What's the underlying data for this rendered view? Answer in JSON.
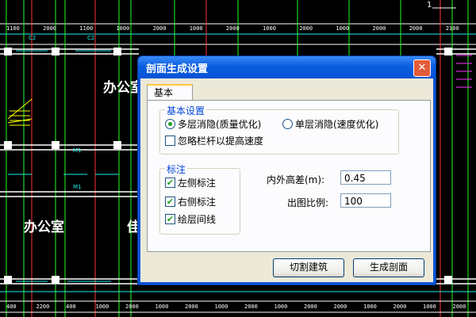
{
  "background": {
    "room_labels": [
      "办公室",
      "办公室",
      "佳"
    ],
    "dimension_top": [
      "1100",
      "2000",
      "1100",
      "1000",
      "2000",
      "1000",
      "2000",
      "1000",
      "2000",
      "1000",
      "2000",
      "2000",
      "2100"
    ],
    "dimension_bottom": [
      "400",
      "2200",
      "400",
      "1000",
      "2000",
      "1000",
      "2000",
      "1000",
      "2000",
      "1000",
      "2000",
      "2000",
      "1000",
      "2000",
      "1000",
      "2000"
    ],
    "misc_labels": [
      "C2",
      "C2",
      "M1",
      "M1",
      "1"
    ]
  },
  "dialog": {
    "title": "剖面生成设置",
    "tab": "基本",
    "basic_group": {
      "label": "基本设置",
      "option_multi": "多层消隐(质量优化)",
      "option_single": "单层消隐(速度优化)",
      "ignore_railing": "忽略栏杆以提高速度"
    },
    "annotation_group": {
      "label": "标注",
      "left": "左侧标注",
      "right": "右侧标注",
      "draw_lines": "绘层间线"
    },
    "elev_diff": {
      "label": "内外高差(m):",
      "value": "0.45"
    },
    "scale": {
      "label": "出图比例:",
      "value": "100"
    },
    "buttons": {
      "cut": "切割建筑",
      "generate": "生成剖面"
    }
  },
  "colors": {
    "title_bar": "#0a5ee0",
    "client": "#ece9d8",
    "accent_green": "#21a121",
    "cad_bg": "#000000"
  }
}
